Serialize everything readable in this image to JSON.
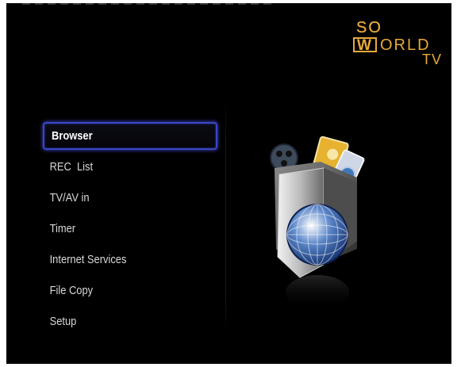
{
  "logo": {
    "line1": "SO",
    "w_letter": "W",
    "line2_rest": "ORLD",
    "line3": "TV"
  },
  "menu": {
    "items": [
      {
        "label": "Browser",
        "selected": true
      },
      {
        "label": "REC  List",
        "selected": false
      },
      {
        "label": "TV/AV in",
        "selected": false
      },
      {
        "label": "Timer",
        "selected": false
      },
      {
        "label": "Internet Services",
        "selected": false
      },
      {
        "label": "File Copy",
        "selected": false
      },
      {
        "label": "Setup",
        "selected": false
      }
    ]
  },
  "illustration": {
    "icon": "media-folder-globe-icon"
  },
  "colors": {
    "background": "#000000",
    "logo": "#e8a93a",
    "selection": "#3b46c9",
    "menu_text": "#d8d8d8"
  }
}
